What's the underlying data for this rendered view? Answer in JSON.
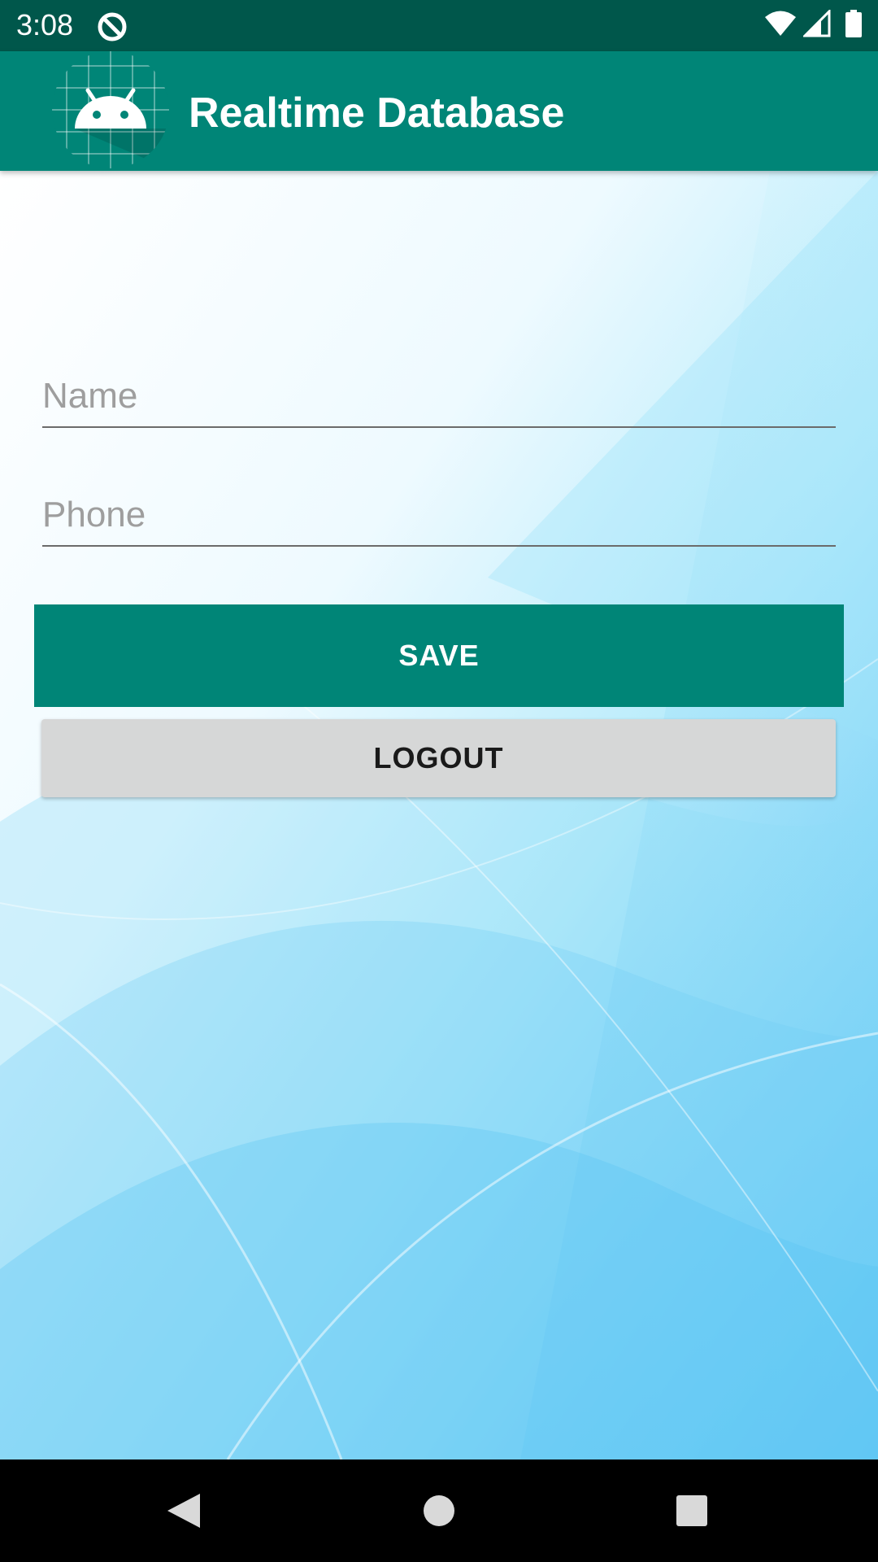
{
  "status_bar": {
    "time": "3:08",
    "left_icon": "data-saver-icon",
    "right_icons": [
      "wifi-icon",
      "cell-signal-icon",
      "battery-icon"
    ]
  },
  "app_bar": {
    "title": "Realtime Database",
    "logo_icon": "android-logo-icon",
    "color": "#008577"
  },
  "form": {
    "name_placeholder": "Name",
    "name_value": "",
    "phone_placeholder": "Phone",
    "phone_value": ""
  },
  "buttons": {
    "save_label": "SAVE",
    "logout_label": "LOGOUT"
  },
  "nav_bar": {
    "items": [
      "back-icon",
      "home-icon",
      "recents-icon"
    ]
  },
  "colors": {
    "status_bar": "#00574b",
    "primary": "#008577",
    "logout_button": "#d6d7d7",
    "background_accent": "#4fc3f7"
  }
}
